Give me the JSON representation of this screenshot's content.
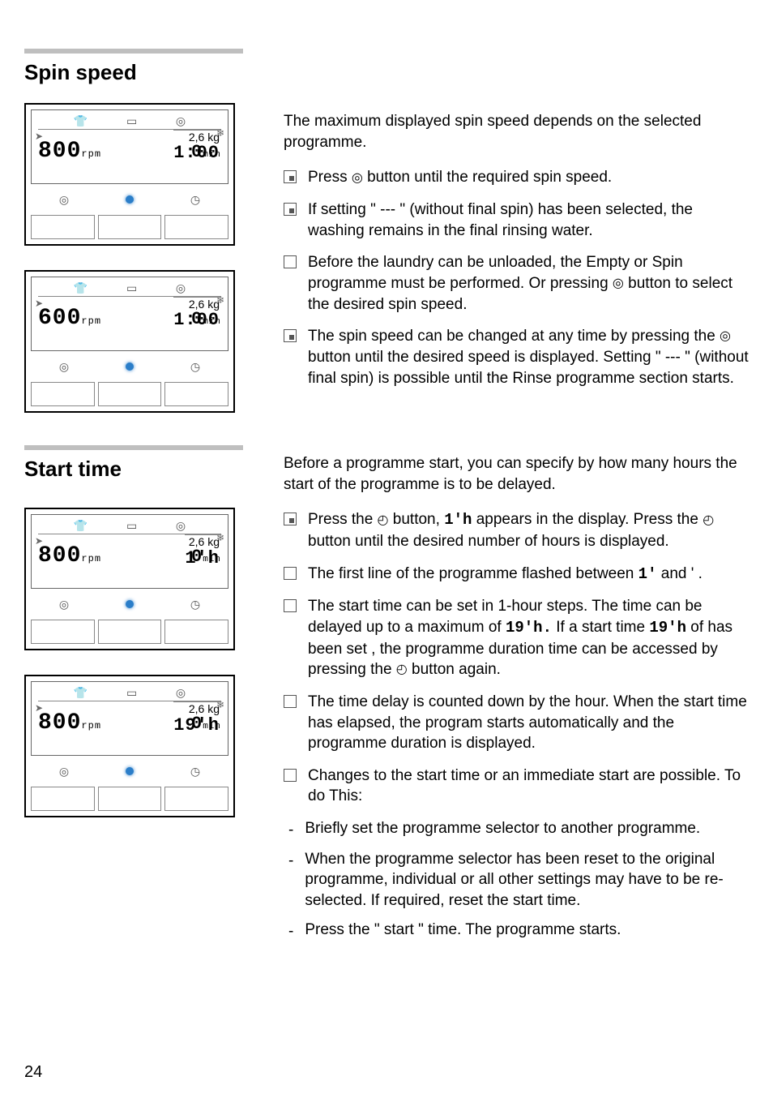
{
  "page_number": "24",
  "spin": {
    "heading": "Spin speed",
    "panels": [
      {
        "rpm": "800",
        "rpm_unit": "rpm",
        "min_val": "0",
        "min_unit": "min",
        "kg": "2,6 kg",
        "time": "1:00"
      },
      {
        "rpm": "600",
        "rpm_unit": "rpm",
        "min_val": "0",
        "min_unit": "min",
        "kg": "2,6 kg",
        "time": "1:00"
      }
    ],
    "intro": "The maximum displayed spin speed depends on the selected programme.",
    "items": [
      {
        "cls": "step",
        "pre": "Press",
        "post": "button until the required spin speed."
      },
      {
        "cls": "step",
        "text": "If setting \" --- \" (without final spin) has been selected, the washing remains in the final rinsing water."
      },
      {
        "cls": "",
        "pre": "Before the laundry can be unloaded, the Empty or Spin programme must be performed. Or pressing",
        "post": " button to select the desired spin speed."
      },
      {
        "cls": "step",
        "pre": "The spin speed can be changed at any time by pressing the ",
        "mid": " button until the desired speed is displayed. Setting \" --- \" (without final spin) is possible until the Rinse programme section starts."
      }
    ]
  },
  "start": {
    "heading": "Start time",
    "panels": [
      {
        "rpm": "800",
        "rpm_unit": "rpm",
        "min_val": "0",
        "min_unit": "min",
        "kg": "2,6 kg",
        "time": "1'h"
      },
      {
        "rpm": "800",
        "rpm_unit": "rpm",
        "min_val": "0",
        "min_unit": "min",
        "kg": "2,6 kg",
        "time": "19'h"
      }
    ],
    "intro": "Before a programme start, you can specify by how many hours the start of the programme is to be delayed.",
    "items": [
      {
        "cls": "step",
        "a": "Press the ",
        "b": " button,",
        "c": "1'h",
        "d": " appears in the display. Press the ",
        "e": " button until the desired number of hours is displayed."
      },
      {
        "cls": "",
        "a": "The first line of the programme flashed between",
        "b": "1'",
        "c": "and ' ."
      },
      {
        "cls": "",
        "a": "The start time can be set in 1-hour steps. The time can be delayed up to a maximum of",
        "b": "19'h.",
        "c": " If a start time",
        "d": "19'h",
        "e": "of has been set , the programme duration time can be accessed by pressing the ",
        "f": " button again."
      },
      {
        "cls": "",
        "text": "The time delay is counted down by the hour. When the start time has elapsed, the program starts automatically and the programme duration is displayed."
      },
      {
        "cls": "",
        "text": "Changes to the start time or an immediate start are possible. To do This:"
      }
    ],
    "dashes": [
      "Briefly set the programme selector to another programme.",
      "When the programme selector has been reset to the original programme, individual or all other settings may have to be re-selected. If required, reset the start time.",
      "Press the \" start \" time. The programme starts."
    ]
  },
  "icons": {
    "spin": "◎",
    "clock": "◴",
    "basin": "▭",
    "shirt": "⌂",
    "timer": "◷"
  }
}
